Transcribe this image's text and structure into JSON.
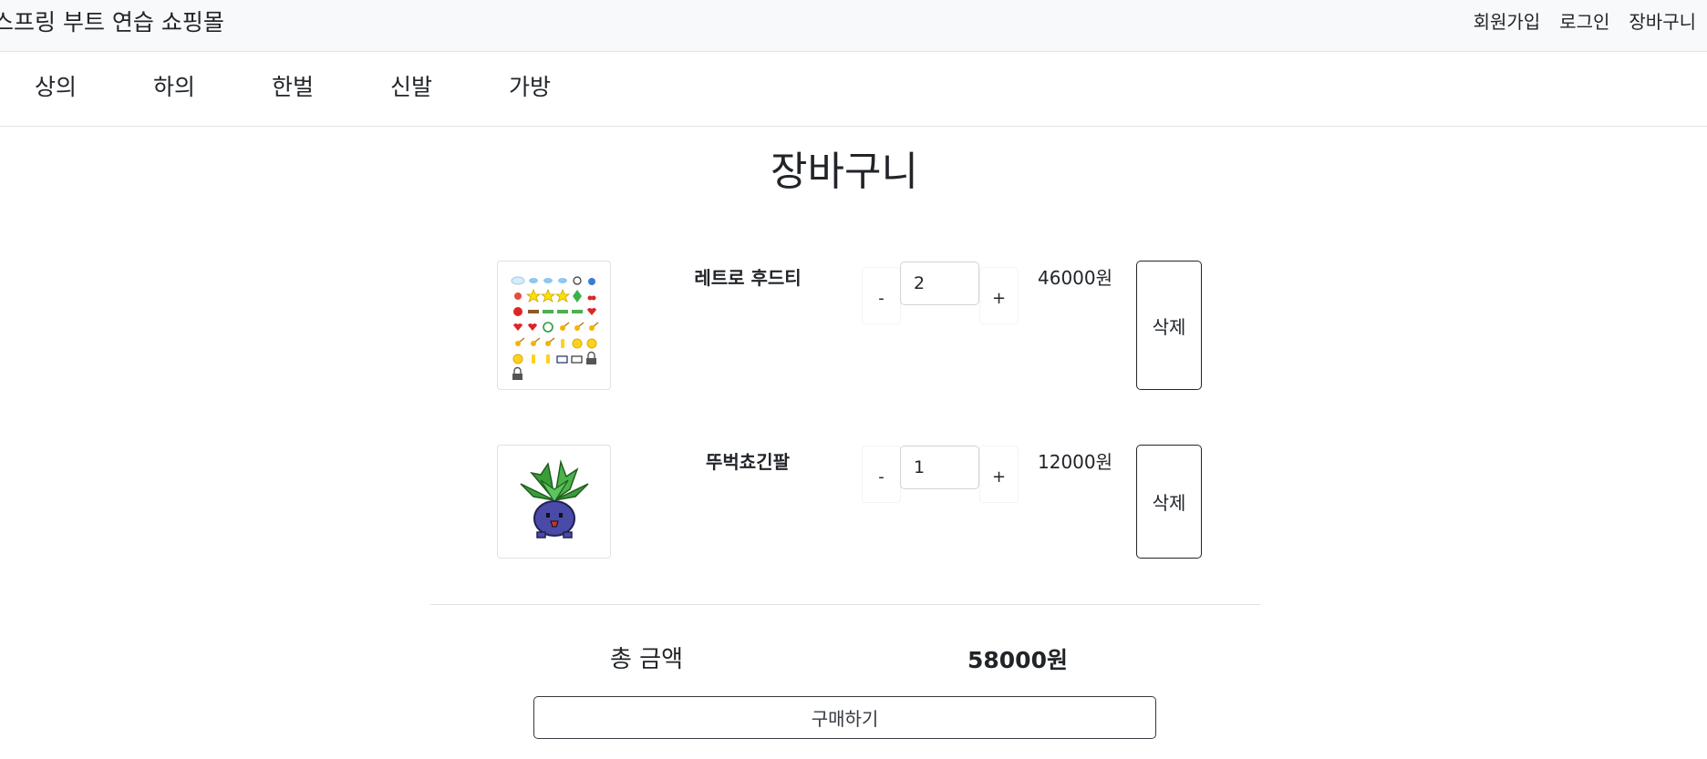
{
  "header": {
    "brand": "스프링 부트 연습 쇼핑몰",
    "nav": {
      "signup": "회원가입",
      "login": "로그인",
      "cart": "장바구니"
    }
  },
  "categories": [
    "상의",
    "하의",
    "한벌",
    "신발",
    "가방"
  ],
  "page": {
    "title": "장바구니"
  },
  "cart": {
    "items": [
      {
        "name": "레트로 후드티",
        "qty": "2",
        "price": "46000원",
        "image_icon": "pixel-item-sprite-sheet",
        "minus": "-",
        "plus": "+",
        "delete": "삭제"
      },
      {
        "name": "뚜벅쵸긴팔",
        "qty": "1",
        "price": "12000원",
        "image_icon": "pixel-oddish-plant-character",
        "minus": "-",
        "plus": "+",
        "delete": "삭제"
      }
    ],
    "total_label": "총 금액",
    "total_value": "58000원",
    "buy_label": "구매하기"
  }
}
